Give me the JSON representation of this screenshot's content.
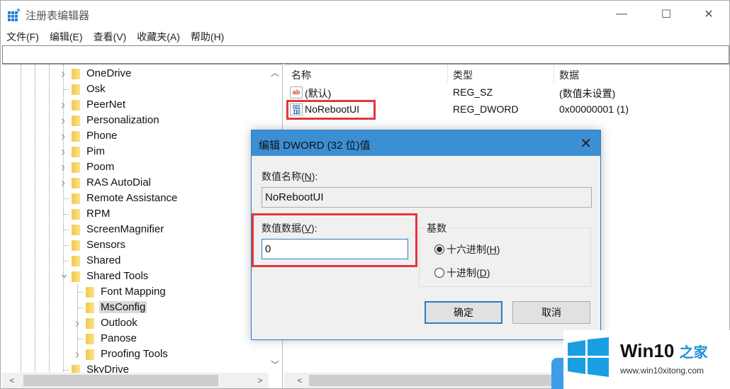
{
  "window": {
    "title": "注册表编辑器",
    "controls": {
      "minimize": "—",
      "maximize": "☐",
      "close": "✕"
    }
  },
  "menu": [
    "文件(F)",
    "编辑(E)",
    "查看(V)",
    "收藏夹(A)",
    "帮助(H)"
  ],
  "address": "",
  "tree": {
    "items": [
      {
        "label": "OneDrive",
        "level": 0,
        "expander": "collapsed"
      },
      {
        "label": "Osk",
        "level": 0,
        "expander": "none"
      },
      {
        "label": "PeerNet",
        "level": 0,
        "expander": "collapsed"
      },
      {
        "label": "Personalization",
        "level": 0,
        "expander": "collapsed"
      },
      {
        "label": "Phone",
        "level": 0,
        "expander": "collapsed"
      },
      {
        "label": "Pim",
        "level": 0,
        "expander": "collapsed"
      },
      {
        "label": "Poom",
        "level": 0,
        "expander": "collapsed"
      },
      {
        "label": "RAS AutoDial",
        "level": 0,
        "expander": "collapsed"
      },
      {
        "label": "Remote Assistance",
        "level": 0,
        "expander": "none"
      },
      {
        "label": "RPM",
        "level": 0,
        "expander": "none"
      },
      {
        "label": "ScreenMagnifier",
        "level": 0,
        "expander": "none"
      },
      {
        "label": "Sensors",
        "level": 0,
        "expander": "none"
      },
      {
        "label": "Shared",
        "level": 0,
        "expander": "none"
      },
      {
        "label": "Shared Tools",
        "level": 0,
        "expander": "expanded"
      },
      {
        "label": "Font Mapping",
        "level": 1,
        "expander": "none"
      },
      {
        "label": "MsConfig",
        "level": 1,
        "expander": "none",
        "selected": true
      },
      {
        "label": "Outlook",
        "level": 1,
        "expander": "collapsed"
      },
      {
        "label": "Panose",
        "level": 1,
        "expander": "none"
      },
      {
        "label": "Proofing Tools",
        "level": 1,
        "expander": "collapsed"
      },
      {
        "label": "SkyDrive",
        "level": 0,
        "expander": "none"
      }
    ]
  },
  "list": {
    "columns": [
      "名称",
      "类型",
      "数据"
    ],
    "rows": [
      {
        "icon": "reg-sz-icon",
        "icon_text": "ab",
        "name": "(默认)",
        "type": "REG_SZ",
        "data": "(数值未设置)"
      },
      {
        "icon": "reg-dword-icon",
        "icon_text": "011\n110",
        "name": "NoRebootUI",
        "type": "REG_DWORD",
        "data": "0x00000001 (1)",
        "highlighted": true
      }
    ]
  },
  "dialog": {
    "title": "编辑 DWORD (32 位)值",
    "value_name_label": "数值名称(",
    "value_name_key": "N",
    "value_name_suffix": "):",
    "value_name": "NoRebootUI",
    "value_data_label": "数值数据(",
    "value_data_key": "V",
    "value_data_suffix": "):",
    "value_data": "0",
    "base_label": "基数",
    "radios": [
      {
        "label": "十六进制(",
        "key": "H",
        "suffix": ")",
        "checked": true
      },
      {
        "label": "十进制(",
        "key": "D",
        "suffix": ")",
        "checked": false
      }
    ],
    "ok_label": "确定",
    "cancel_label": "取消"
  },
  "watermark": {
    "title": "Win10 ",
    "title_cn": "之家",
    "url": "www.win10xitong.com"
  },
  "colors": {
    "accent": "#3d8fd3",
    "highlight_box": "#e3373e",
    "folder": "#f2c94c"
  }
}
